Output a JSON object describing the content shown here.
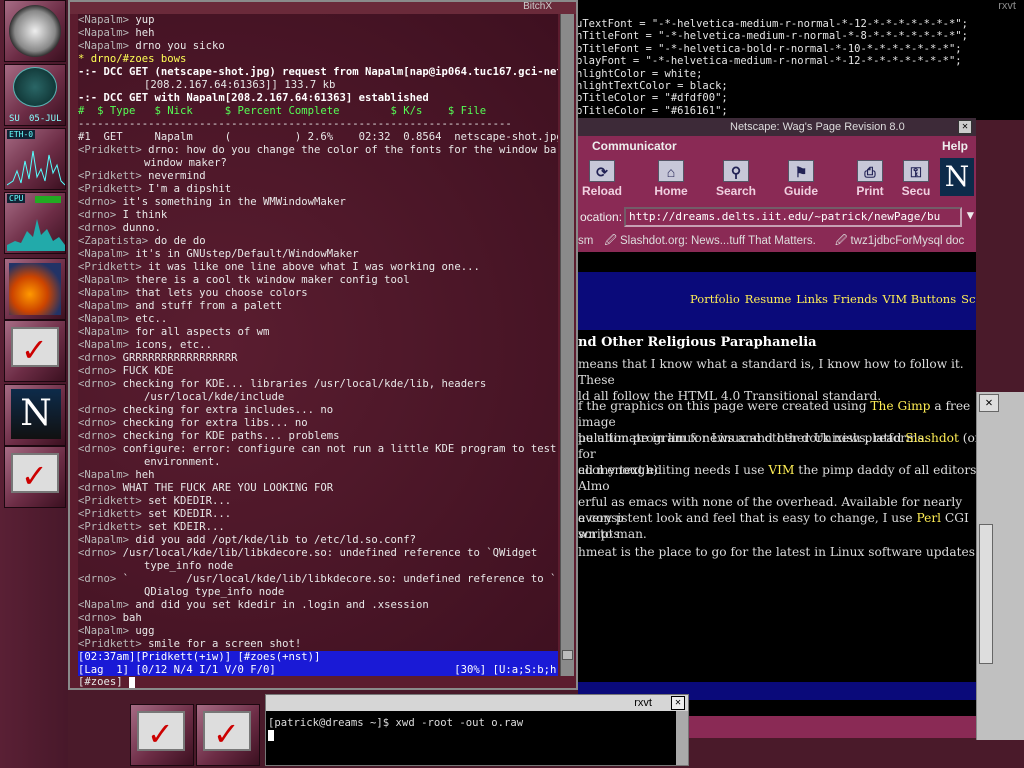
{
  "bg_rxvt": {
    "title": "rxvt",
    "lines": [
      "uTextFont = \"-*-helvetica-medium-r-normal-*-12-*-*-*-*-*-*-*\";",
      "nTitleFont = \"-*-helvetica-medium-r-normal-*-8-*-*-*-*-*-*-*\";",
      "pTitleFont = \"-*-helvetica-bold-r-normal-*-10-*-*-*-*-*-*-*\";",
      "playFont = \"-*-helvetica-medium-r-normal-*-12-*-*-*-*-*-*-*\";",
      "hlightColor = white;",
      "hlightTextColor = black;",
      "pTitleColor = \"#dfdf00\";",
      "pTitleColor = \"#616161\";"
    ]
  },
  "dock": {
    "clock_day": "SU",
    "clock_date": "05-JUL",
    "eth_label": "ETH-0",
    "cpu_label": "CPU"
  },
  "bitchx": {
    "title": "BitchX",
    "lines": [
      {
        "nick": "Napalm",
        "text": "yup"
      },
      {
        "nick": "Napalm",
        "text": "heh"
      },
      {
        "nick": "Napalm",
        "text": "drno you sicko"
      },
      {
        "raw": "* drno/#zoes bows"
      },
      {
        "raw": "-:- DCC GET (netscape-shot.jpg) request from Napalm[nap@ip064.tuc167.gci-net.com"
      },
      {
        "wrap": "[208.2.167.64:61363]] 133.7 kb"
      },
      {
        "raw": "-:- DCC GET with Napalm[208.2.167.64:61363] established"
      },
      {
        "raw": "#  $ Type   $ Nick     $ Percent Complete        $ K/s    $ File"
      },
      {
        "raw": "--------------------------------------------------------------------"
      },
      {
        "raw": "#1  GET     Napalm     (          ) 2.6%    02:32  0.8564  netscape-shot.jpg"
      },
      {
        "nick": "Pridkett",
        "text": "drno: how do you change the color of the fonts for the window bars in"
      },
      {
        "wrap": "window maker?"
      },
      {
        "nick": "Pridkett",
        "text": "nevermind"
      },
      {
        "nick": "Pridkett",
        "text": "I'm a dipshit"
      },
      {
        "nick": "drno",
        "text": "it's something in the WMWindowMaker"
      },
      {
        "nick": "drno",
        "text": "I think"
      },
      {
        "nick": "drno",
        "text": "dunno."
      },
      {
        "nick": "Zapatista",
        "text": "do de do"
      },
      {
        "nick": "Napalm",
        "text": "it's in GNUstep/Default/WindowMaker"
      },
      {
        "nick": "Pridkett",
        "text": "it was like one line above what I was working one..."
      },
      {
        "nick": "Napalm",
        "text": "there is a cool tk window maker config tool"
      },
      {
        "nick": "Napalm",
        "text": "that lets you choose colors"
      },
      {
        "nick": "Napalm",
        "text": "and stuff from a palett"
      },
      {
        "nick": "Napalm",
        "text": "etc.."
      },
      {
        "nick": "Napalm",
        "text": "for all aspects of wm"
      },
      {
        "nick": "Napalm",
        "text": "icons, etc.."
      },
      {
        "nick": "drno",
        "text": "GRRRRRRRRRRRRRRRRR"
      },
      {
        "nick": "drno",
        "text": "FUCK KDE"
      },
      {
        "nick": "drno",
        "text": "checking for KDE... libraries /usr/local/kde/lib, headers"
      },
      {
        "wrap": "/usr/local/kde/include"
      },
      {
        "nick": "drno",
        "text": "checking for extra includes... no"
      },
      {
        "nick": "drno",
        "text": "checking for extra libs... no"
      },
      {
        "nick": "drno",
        "text": "checking for KDE paths... problems"
      },
      {
        "nick": "drno",
        "text": "configure: error: configure can not run a little KDE program to test the"
      },
      {
        "wrap": "environment."
      },
      {
        "nick": "Napalm",
        "text": "heh"
      },
      {
        "nick": "drno",
        "text": "WHAT THE FUCK ARE YOU LOOKING FOR"
      },
      {
        "nick": "Pridkett",
        "text": "set KDEDIR..."
      },
      {
        "nick": "Pridkett",
        "text": "set KDEDIR..."
      },
      {
        "nick": "Pridkett",
        "text": "set KDEIR..."
      },
      {
        "nick": "Napalm",
        "text": "did you add /opt/kde/lib to /etc/ld.so.conf?"
      },
      {
        "nick": "drno",
        "text": "/usr/local/kde/lib/libkdecore.so: undefined reference to `QWidget"
      },
      {
        "wrap": "type_info node"
      },
      {
        "nick": "drno",
        "text": "`         /usr/local/kde/lib/libkdecore.so: undefined reference to `"
      },
      {
        "wrap": "QDialog type_info node"
      },
      {
        "nick": "Napalm",
        "text": "and did you set kdedir in .login and .xsession"
      },
      {
        "nick": "drno",
        "text": "bah"
      },
      {
        "nick": "Napalm",
        "text": "ugg"
      },
      {
        "nick": "Pridkett",
        "text": "smile for a screen shot!"
      }
    ],
    "status1": "[02:37am][Pridkett(+iw)] [#zoes(+nst)]",
    "status2": "[Lag  1] [0/12 N/4 I/1 V/0 F/0]                            [30%] [U:a;S:b;h]",
    "input": "[#zoes] "
  },
  "netscape": {
    "title": "Netscape: Wag's Page Revision 8.0",
    "menu": [
      "Communicator",
      "Help"
    ],
    "toolbar": [
      "Reload",
      "Home",
      "Search",
      "Guide",
      "Print",
      "Secu"
    ],
    "location_label": "ocation:",
    "url": "http://dreams.delts.iit.edu/~patrick/newPage/bu",
    "bookmarks": [
      "sm",
      "Slashdot.org: News...tuff That Matters.",
      "twz1jdbcForMysql doc"
    ],
    "nav_links": [
      "Portfolio",
      "Resume",
      "Links",
      "Friends",
      "VIM Buttons",
      "Screensho"
    ],
    "heading": "nd Other Religious Paraphanelia",
    "paragraphs": [
      {
        "segments": [
          {
            "t": " means that I know what a standard is, I know how to follow it. These"
          },
          {
            "t": "\nld all follow the HTML 4.0 Transitional standard."
          }
        ]
      },
      {
        "segments": [
          {
            "t": "f the graphics on this page were created using "
          },
          {
            "t": "The Gimp",
            "link": true
          },
          {
            "t": " a free image"
          },
          {
            "t": "\npulation program for Linux and other Unixish platforms."
          }
        ]
      },
      {
        "segments": [
          {
            "t": "he ultimate in linux news and other dork news, read "
          },
          {
            "t": "Slashdot",
            "link": true
          },
          {
            "t": " (or/. for"
          },
          {
            "t": "\n cool enough)."
          }
        ]
      },
      {
        "segments": [
          {
            "t": "all my text editing needs I use "
          },
          {
            "t": "VIM",
            "link": true
          },
          {
            "t": " the pimp daddy of all editors. Almo"
          },
          {
            "t": "\nerful as emacs with none of the overhead. Available for nearly every p"
          },
          {
            "t": "\nwn to man."
          }
        ]
      },
      {
        "segments": [
          {
            "t": " a consistent look and feel that is easy to change, I use "
          },
          {
            "t": "Perl",
            "link": true
          },
          {
            "t": " CGI scripts"
          }
        ]
      },
      {
        "segments": [
          {
            "t": "hmeat is the place to go for the latest in Linux software updates."
          }
        ]
      }
    ]
  },
  "rxvt2": {
    "title": "rxvt",
    "prompt": "[patrick@dreams ~]$ xwd -root -out o.raw"
  }
}
